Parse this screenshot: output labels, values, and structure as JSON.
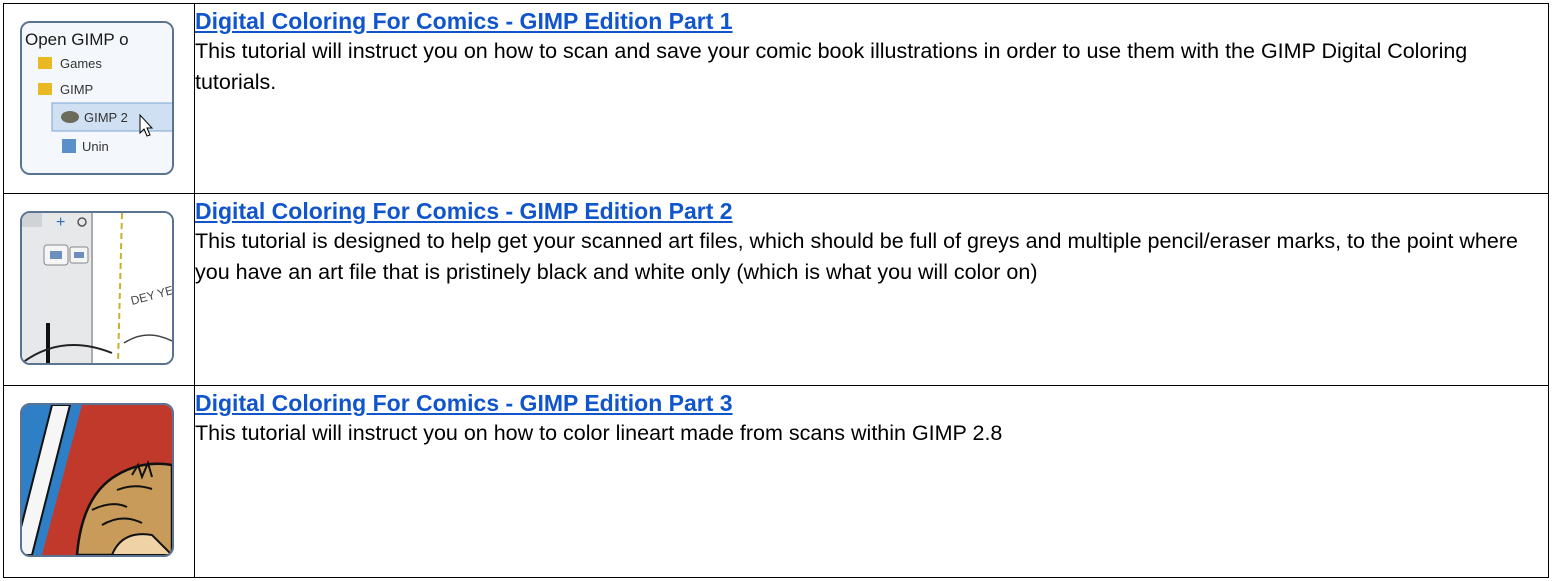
{
  "tutorials": [
    {
      "title": "Digital Coloring For Comics - GIMP Edition Part 1",
      "description": "This tutorial will instruct you on how to scan and save your comic book illustrations in order to use them with the GIMP Digital Coloring tutorials.",
      "thumb": {
        "header": "Open GIMP o",
        "items": [
          "Games",
          "GIMP",
          "GIMP 2",
          "Unin"
        ]
      }
    },
    {
      "title": "Digital Coloring For Comics - GIMP Edition Part 2",
      "description": "This tutorial is designed to help get your scanned art files, which should be full of greys and multiple pencil/eraser marks, to the point where you have an art file that is pristinely black and white only (which is what you will color on)",
      "thumb": {
        "text": "DEY YES"
      }
    },
    {
      "title": "Digital Coloring For Comics - GIMP Edition Part 3",
      "description": "This tutorial will instruct you on how to color lineart made from scans within GIMP 2.8"
    }
  ],
  "colors": {
    "link": "#1155cc",
    "thumb_border": "#5a7393",
    "comic_red": "#c0392b",
    "comic_blue": "#2f7fc6"
  }
}
